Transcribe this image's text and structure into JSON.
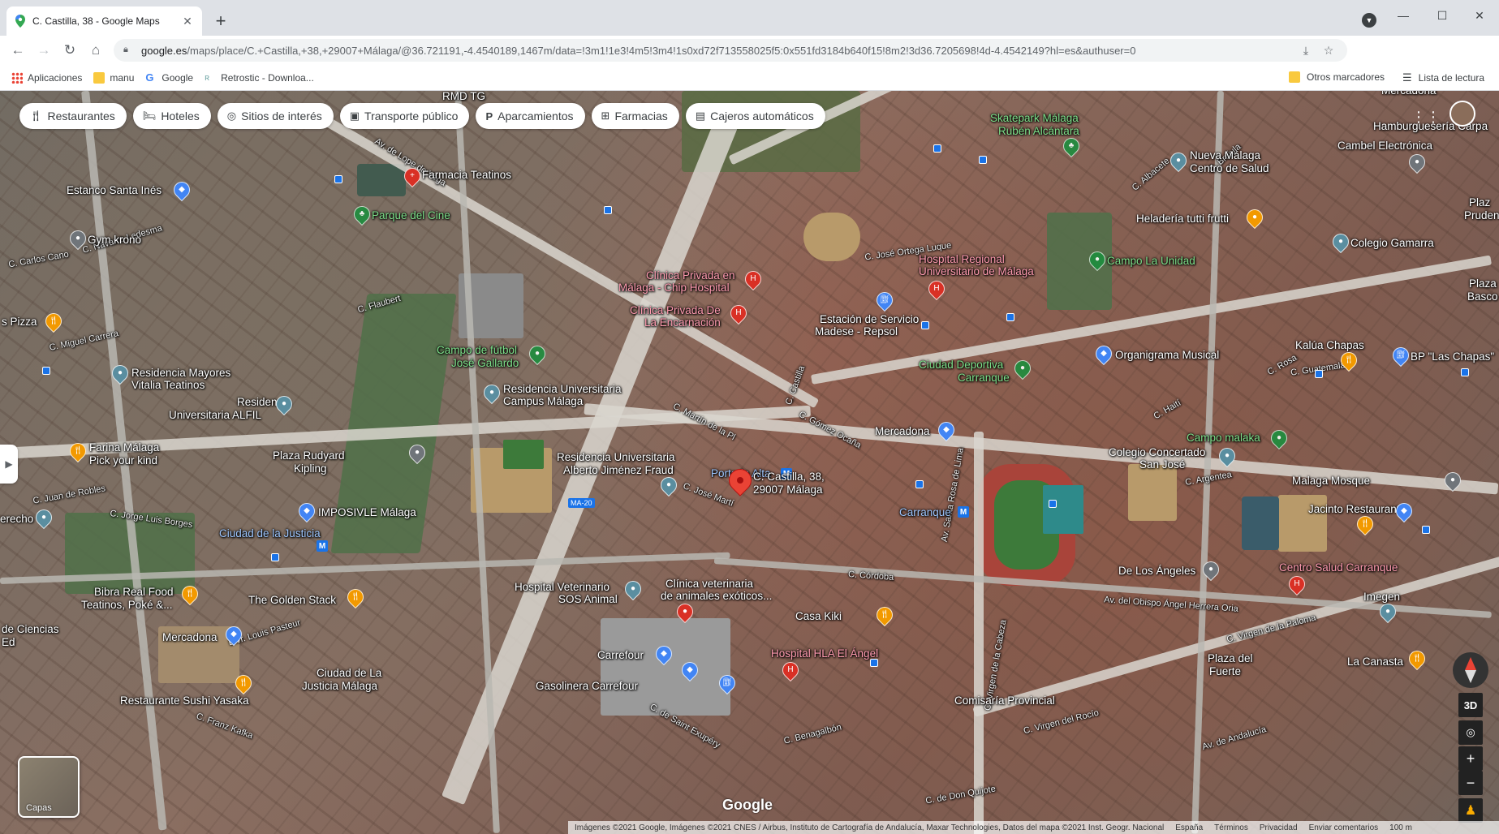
{
  "browser": {
    "tab_title": "C. Castilla, 38 - Google Maps",
    "new_tab": "+",
    "url_host": "google.es",
    "url_path": "/maps/place/C.+Castilla,+38,+29007+Málaga/@36.721191,-4.4540189,1467m/data=!3m1!1e3!4m5!3m4!1s0xd72f713558025f5:0x551fd3184b640f15!8m2!3d36.7205698!4d-4.4542149?hl=es&authuser=0"
  },
  "bookmarks": {
    "items": [
      {
        "label": "Aplicaciones",
        "icon": "apps-grid-icon"
      },
      {
        "label": "manu",
        "icon": "folder-icon"
      },
      {
        "label": "Google",
        "icon": "google-icon"
      },
      {
        "label": "Retrostic - Downloa...",
        "icon": "retrostic-icon"
      }
    ],
    "other": "Otros marcadores",
    "reading_list": "Lista de lectura"
  },
  "chips": [
    {
      "label": "Restaurantes",
      "icon": "fork-knife-icon"
    },
    {
      "label": "Hoteles",
      "icon": "bed-icon"
    },
    {
      "label": "Sitios de interés",
      "icon": "camera-icon"
    },
    {
      "label": "Transporte público",
      "icon": "bus-icon"
    },
    {
      "label": "Aparcamientos",
      "icon": "parking-icon"
    },
    {
      "label": "Farmacias",
      "icon": "pharmacy-icon"
    },
    {
      "label": "Cajeros automáticos",
      "icon": "atm-icon"
    }
  ],
  "selected_place": {
    "line1": "C. Castilla, 38,",
    "line2": "29007 Málaga"
  },
  "places": [
    {
      "l1": "RMD TG",
      "l2": ""
    },
    {
      "l1": "Farmacia Teatinos",
      "l2": ""
    },
    {
      "l1": "Estanco Santa Inés",
      "l2": ""
    },
    {
      "l1": "Parque del Cine",
      "l2": ""
    },
    {
      "l1": "Gym krono",
      "l2": ""
    },
    {
      "l1": "s Pizza",
      "l2": ""
    },
    {
      "l1": "Residencia Mayores",
      "l2": "Vitalia Teatinos"
    },
    {
      "l1": "Residencia",
      "l2": "Universitaria ALFIL"
    },
    {
      "l1": "Farina Málaga",
      "l2": "Pick your kind"
    },
    {
      "l1": "Plaza Rudyard",
      "l2": "Kipling"
    },
    {
      "l1": "erecho",
      "l2": ""
    },
    {
      "l1": "IMPOSIVLE Málaga",
      "l2": ""
    },
    {
      "l1": "Ciudad de la Justicia",
      "l2": ""
    },
    {
      "l1": "Bibra Real Food",
      "l2": "Teatinos, Poké &..."
    },
    {
      "l1": "The Golden Stack",
      "l2": ""
    },
    {
      "l1": "Mercadona",
      "l2": ""
    },
    {
      "l1": "de Ciencias",
      "l2": "Ed"
    },
    {
      "l1": "Ciudad de La",
      "l2": "Justicia Málaga"
    },
    {
      "l1": "Restaurante Sushi Yasaka",
      "l2": ""
    },
    {
      "l1": "Campo de fútbol",
      "l2": "José Gallardo"
    },
    {
      "l1": "Residencia Universitaria",
      "l2": "Campus Málaga"
    },
    {
      "l1": "Residencia Universitaria",
      "l2": "Alberto Jiménez Fraud"
    },
    {
      "l1": "Portada Alta",
      "l2": ""
    },
    {
      "l1": "Clínica Privada en",
      "l2": "Málaga - Chip Hospital"
    },
    {
      "l1": "Clínica Privada De",
      "l2": "La Encarnación"
    },
    {
      "l1": "Estación de Servicio",
      "l2": "Madese - Repsol"
    },
    {
      "l1": "Hospital Regional",
      "l2": "Universitario de Málaga"
    },
    {
      "l1": "Skatepark Málaga",
      "l2": "Rubén Alcántara"
    },
    {
      "l1": "Nueva Málaga",
      "l2": "Centro de Salud"
    },
    {
      "l1": "Heladería tutti frutti",
      "l2": ""
    },
    {
      "l1": "Campo La Unidad",
      "l2": ""
    },
    {
      "l1": "Ciudad Deportiva",
      "l2": "Carranque"
    },
    {
      "l1": "Mercadona",
      "l2": ""
    },
    {
      "l1": "Organigrama Musical",
      "l2": ""
    },
    {
      "l1": "Kalúa Chapas",
      "l2": ""
    },
    {
      "l1": "BP \"Las Chapas\"",
      "l2": ""
    },
    {
      "l1": "Colegio Gamarra",
      "l2": ""
    },
    {
      "l1": "Cambel Electrónica",
      "l2": ""
    },
    {
      "l1": "Hamburguesería Carpa",
      "l2": ""
    },
    {
      "l1": "Mercadona",
      "l2": ""
    },
    {
      "l1": "Campo malaka",
      "l2": ""
    },
    {
      "l1": "Colegio Concertado",
      "l2": "San José"
    },
    {
      "l1": "Malaga Mosque",
      "l2": ""
    },
    {
      "l1": "Carranque",
      "l2": ""
    },
    {
      "l1": "Jacinto Restaurante",
      "l2": ""
    },
    {
      "l1": "De Los Ángeles",
      "l2": ""
    },
    {
      "l1": "Centro Salud Carranque",
      "l2": ""
    },
    {
      "l1": "Imegen",
      "l2": ""
    },
    {
      "l1": "Hospital Veterinario",
      "l2": "SOS Animal"
    },
    {
      "l1": "Clínica veterinaria",
      "l2": "de animales exóticos..."
    },
    {
      "l1": "Casa Kiki",
      "l2": ""
    },
    {
      "l1": "Hospital HLA El Ángel",
      "l2": ""
    },
    {
      "l1": "Carrefour",
      "l2": ""
    },
    {
      "l1": "Gasolinera Carrefour",
      "l2": ""
    },
    {
      "l1": "Plaza del",
      "l2": "Fuerte"
    },
    {
      "l1": "La Canasta",
      "l2": ""
    },
    {
      "l1": "Comisaría Provincial",
      "l2": ""
    },
    {
      "l1": "Plaza",
      "l2": "Basco"
    },
    {
      "l1": "Plaz",
      "l2": "Pruden Jimén"
    }
  ],
  "streets": [
    "Av. de Lope de Vega",
    "C. Navarro Ledesma",
    "C. Carlos Cano",
    "C. Miguel Carrera",
    "C. Flaubert",
    "C. Juan de Robles",
    "C. Jorge Luis Borges",
    "Blvr. Louis Pasteur",
    "C. Franz Kafka",
    "Av. del Obispo Ángel Herrera Oria",
    "Av. de Andalucía",
    "C. Castilla",
    "C. Martín de la Pl",
    "C. Gómez Ocaña",
    "C. José Martí",
    "C. Guatemala",
    "C. Argentea",
    "C. José Ortega Luque",
    "C. Virgen de la Paloma",
    "Av. Santa Rosa de Lima",
    "C. Virgen de la Cabeza",
    "C. de Saint Exupéry",
    "C. Benagalbón",
    "C. de Don Quijote",
    "C. Virgen del Rocío",
    "C. Córdoba",
    "C. Albacete",
    "C. Brújula",
    "C. Haití",
    "C. Rosa"
  ],
  "map": {
    "attribution": "Imágenes ©2021 Google, Imágenes ©2021 CNES / Airbus, Instituto de Cartografía de Andalucía, Maxar Technologies, Datos del mapa ©2021 Inst. Geogr. Nacional",
    "country": "España",
    "terms": "Términos",
    "privacy": "Privacidad",
    "feedback": "Enviar comentarios",
    "scale": "100 m",
    "layers_label": "Capas",
    "google_mark": "Google",
    "btn_3d": "3D",
    "zoom_in": "+",
    "zoom_out": "−",
    "motorway": "MA-20"
  }
}
